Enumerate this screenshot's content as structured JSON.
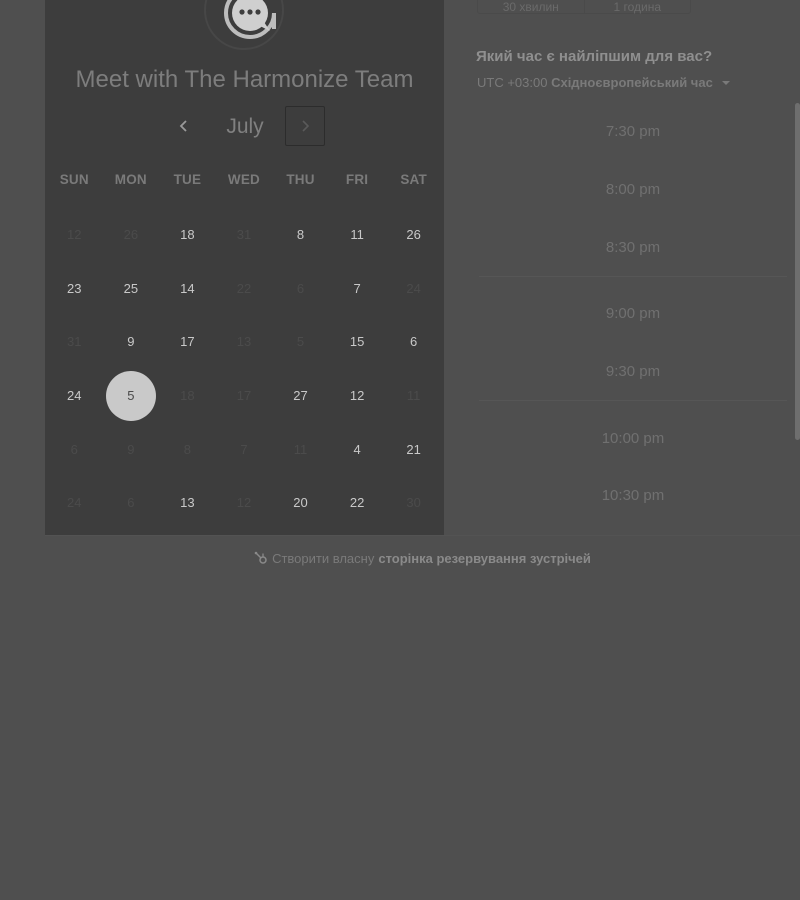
{
  "header": {
    "logo_icon": "chat-bubble-logo-icon",
    "title": "Meet with The Harmonize Team"
  },
  "calendar": {
    "month": "July",
    "prev_icon": "chevron-left-icon",
    "next_icon": "chevron-right-icon",
    "weekdays": [
      "SUN",
      "MON",
      "TUE",
      "WED",
      "THU",
      "FRI",
      "SAT"
    ],
    "weeks": [
      [
        {
          "d": "12",
          "s": "disabled"
        },
        {
          "d": "26",
          "s": "disabled"
        },
        {
          "d": "18",
          "s": "available"
        },
        {
          "d": "31",
          "s": "disabled"
        },
        {
          "d": "8",
          "s": "available"
        },
        {
          "d": "11",
          "s": "available"
        },
        {
          "d": "26",
          "s": "available"
        }
      ],
      [
        {
          "d": "23",
          "s": "available"
        },
        {
          "d": "25",
          "s": "available"
        },
        {
          "d": "14",
          "s": "available"
        },
        {
          "d": "22",
          "s": "disabled"
        },
        {
          "d": "6",
          "s": "disabled"
        },
        {
          "d": "7",
          "s": "available"
        },
        {
          "d": "24",
          "s": "disabled"
        }
      ],
      [
        {
          "d": "31",
          "s": "disabled"
        },
        {
          "d": "9",
          "s": "available"
        },
        {
          "d": "17",
          "s": "available"
        },
        {
          "d": "13",
          "s": "disabled"
        },
        {
          "d": "5",
          "s": "disabled"
        },
        {
          "d": "15",
          "s": "available"
        },
        {
          "d": "6",
          "s": "available"
        }
      ],
      [
        {
          "d": "24",
          "s": "available"
        },
        {
          "d": "5",
          "s": "selected"
        },
        {
          "d": "18",
          "s": "disabled"
        },
        {
          "d": "17",
          "s": "disabled"
        },
        {
          "d": "27",
          "s": "available"
        },
        {
          "d": "12",
          "s": "available"
        },
        {
          "d": "11",
          "s": "disabled"
        }
      ],
      [
        {
          "d": "6",
          "s": "disabled"
        },
        {
          "d": "9",
          "s": "disabled"
        },
        {
          "d": "8",
          "s": "disabled"
        },
        {
          "d": "7",
          "s": "disabled"
        },
        {
          "d": "11",
          "s": "disabled"
        },
        {
          "d": "4",
          "s": "available"
        },
        {
          "d": "21",
          "s": "available"
        }
      ],
      [
        {
          "d": "24",
          "s": "disabled"
        },
        {
          "d": "6",
          "s": "disabled"
        },
        {
          "d": "13",
          "s": "available"
        },
        {
          "d": "12",
          "s": "disabled"
        },
        {
          "d": "20",
          "s": "available"
        },
        {
          "d": "22",
          "s": "available"
        },
        {
          "d": "30",
          "s": "disabled"
        }
      ]
    ]
  },
  "duration": {
    "tabs": [
      "30 хвилин",
      "1 година"
    ]
  },
  "time_selection": {
    "question": "Який час є найліпшим для вас?",
    "tz_offset": "UTC +03:00",
    "tz_name": "Східноєвропейський час",
    "slot_groups": [
      [
        "7:30 pm",
        "8:00 pm",
        "8:30 pm"
      ],
      [
        "9:00 pm",
        "9:30 pm"
      ],
      [
        "10:00 pm",
        "10:30 pm"
      ]
    ]
  },
  "footer": {
    "icon": "hubspot-sprocket-icon",
    "text": "Створити власну",
    "link": "сторінка резервування зустрічей"
  },
  "colors": {
    "background": "#4f4f4f",
    "calendar_panel": "#3d3d3d",
    "selected_day": "#c9c9c9"
  }
}
